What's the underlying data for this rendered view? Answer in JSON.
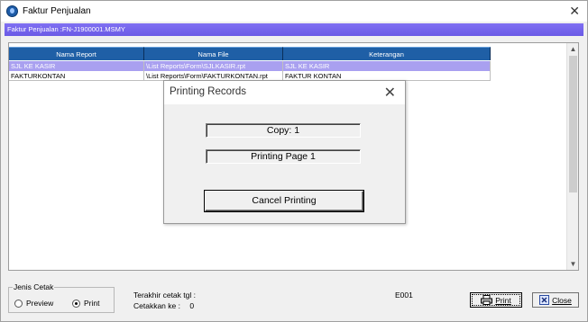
{
  "window": {
    "title": "Faktur Penjualan",
    "subheader": "Faktur Penjualan :FN-J1900001.MSMY"
  },
  "grid": {
    "columns": [
      "Nama Report",
      "Nama File",
      "Keterangan"
    ],
    "rows": [
      {
        "nama_report": "SJL KE KASIR",
        "nama_file": "\\List Reports\\Form\\SJLKASIR.rpt",
        "keterangan": "SJL KE KASIR",
        "selected": true
      },
      {
        "nama_report": "FAKTURKONTAN",
        "nama_file": "\\List Reports\\Form\\FAKTURKONTAN.rpt",
        "keterangan": "FAKTUR KONTAN",
        "selected": false
      }
    ]
  },
  "dialog": {
    "title": "Printing Records",
    "copy": "Copy:  1",
    "page": "Printing Page 1",
    "cancel_label": "Cancel Printing"
  },
  "footer": {
    "jenis_cetak_label": "Jenis Cetak",
    "preview_label": "Preview",
    "print_label": "Print",
    "selected_mode": "Print",
    "terakhir_cetak": "Terakhir cetak tgl :",
    "cetakkan_ke_label": "Cetakkan ke :",
    "cetakkan_ke_value": "0",
    "code": "E001",
    "print_button": "Print",
    "close_button": "Close"
  },
  "colors": {
    "subheader": "#6a5ae6",
    "grid_header": "#1f5fa6",
    "selected_row": "#a9a0f0"
  }
}
